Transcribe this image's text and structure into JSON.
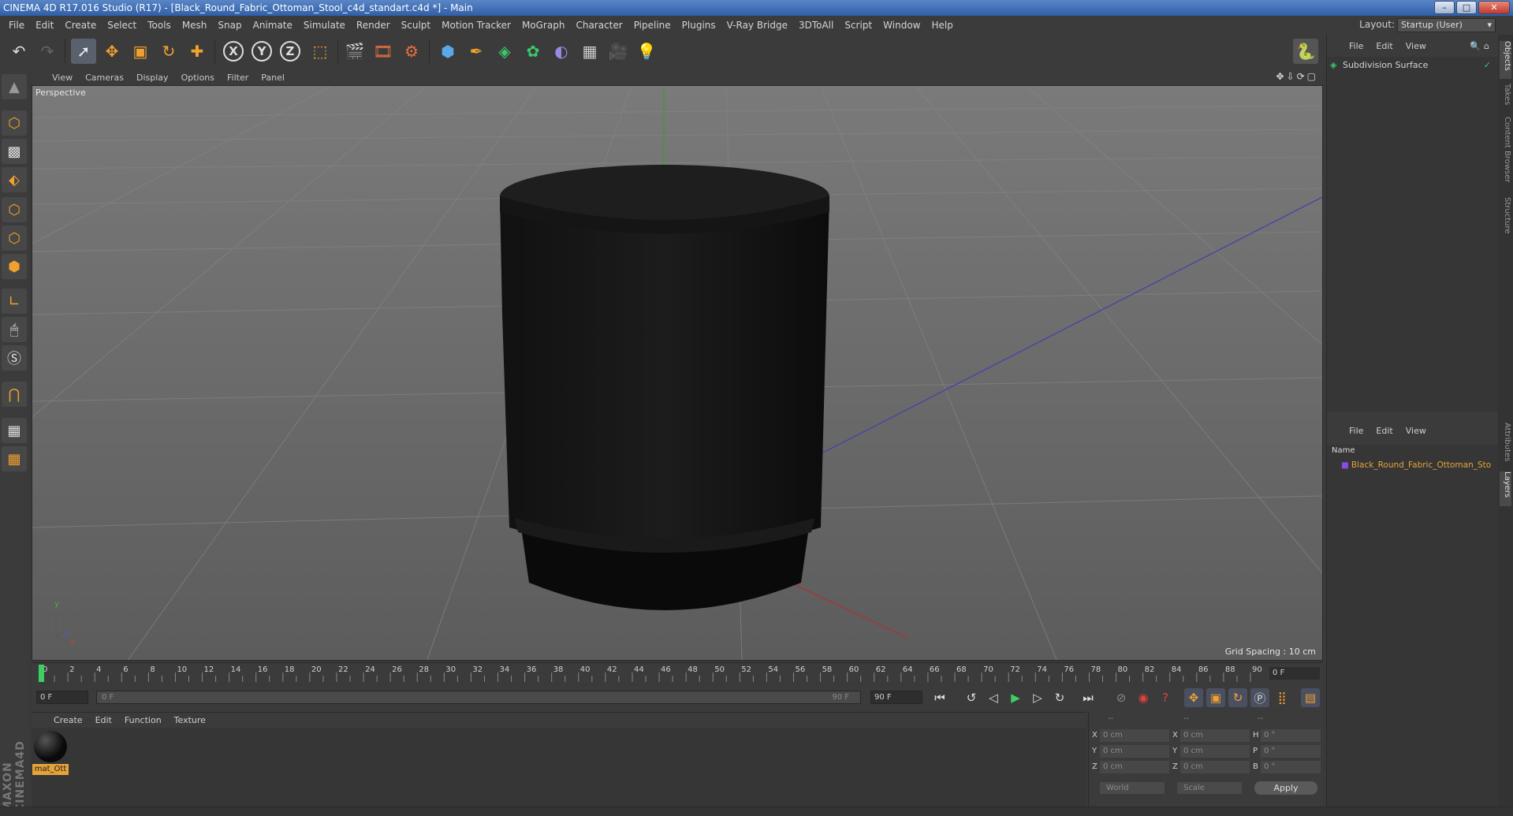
{
  "window": {
    "title": "CINEMA 4D R17.016 Studio (R17) - [Black_Round_Fabric_Ottoman_Stool_c4d_standart.c4d *] - Main",
    "btn_min": "–",
    "btn_max": "□",
    "btn_close": "✕"
  },
  "menu": [
    "File",
    "Edit",
    "Create",
    "Select",
    "Tools",
    "Mesh",
    "Snap",
    "Animate",
    "Simulate",
    "Render",
    "Sculpt",
    "Motion Tracker",
    "MoGraph",
    "Character",
    "Pipeline",
    "Plugins",
    "V-Ray Bridge",
    "3DToAll",
    "Script",
    "Window",
    "Help"
  ],
  "layout": {
    "label": "Layout:",
    "value": "Startup (User)"
  },
  "toolbar": {
    "icons": [
      "undo-icon",
      "redo-icon",
      "select-arrow-icon",
      "move-icon",
      "scale-icon",
      "rotate-icon",
      "transform-icon",
      "x-axis-icon",
      "y-axis-icon",
      "z-axis-icon",
      "coordinate-system-icon",
      "render-view-icon",
      "render-picture-viewer-icon",
      "edit-render-settings-icon",
      "cube-primitive-icon",
      "spline-pen-icon",
      "subdivision-icon",
      "mograph-cloner-icon",
      "deformer-icon",
      "floor-icon",
      "camera-icon",
      "light-icon"
    ],
    "axis_labels": [
      "X",
      "Y",
      "Z"
    ],
    "python_icon": "python-icon"
  },
  "viewport": {
    "menu": [
      "View",
      "Cameras",
      "Display",
      "Options",
      "Filter",
      "Panel"
    ],
    "label": "Perspective",
    "grid_spacing": "Grid Spacing : 10 cm",
    "axis_y": "y",
    "axis_x": "x",
    "axis_z": "z"
  },
  "timeline": {
    "ticks": [
      0,
      2,
      4,
      6,
      8,
      10,
      12,
      14,
      16,
      18,
      20,
      22,
      24,
      26,
      28,
      30,
      32,
      34,
      36,
      38,
      40,
      42,
      44,
      46,
      48,
      50,
      52,
      54,
      56,
      58,
      60,
      62,
      64,
      66,
      68,
      70,
      72,
      74,
      76,
      78,
      80,
      82,
      84,
      86,
      88,
      90
    ],
    "max": 90,
    "current_frame": 0,
    "frame_end_display": "0 F"
  },
  "playbar": {
    "start_field": "0 F",
    "range_start": "0 F",
    "range_end": "90 F",
    "end_field": "90 F"
  },
  "material": {
    "menu": [
      "Create",
      "Edit",
      "Function",
      "Texture"
    ],
    "name": "mat_Ott"
  },
  "maxon_logo": "MAXON CINEMA4D",
  "coords": {
    "header": [
      "--",
      "--",
      "--"
    ],
    "rows": [
      {
        "l1": "X",
        "v1": "0 cm",
        "l2": "X",
        "v2": "0 cm",
        "l3": "H",
        "v3": "0 °"
      },
      {
        "l1": "Y",
        "v1": "0 cm",
        "l2": "Y",
        "v2": "0 cm",
        "l3": "P",
        "v3": "0 °"
      },
      {
        "l1": "Z",
        "v1": "0 cm",
        "l2": "Z",
        "v2": "0 cm",
        "l3": "B",
        "v3": "0 °"
      }
    ],
    "space": "World",
    "mode": "Scale",
    "apply": "Apply"
  },
  "objects": {
    "menu": [
      "File",
      "Edit",
      "View"
    ],
    "item": "Subdivision Surface"
  },
  "layers": {
    "menu": [
      "File",
      "Edit",
      "View"
    ],
    "column": "Name",
    "item": "Black_Round_Fabric_Ottoman_Sto"
  },
  "right_tabs": [
    "Objects",
    "Takes",
    "Content Browser",
    "Structure",
    "Attributes",
    "Layers"
  ],
  "colors": {
    "accent": "#e6a33a",
    "material_label_text": "#1a1a1a",
    "layer_item": "#e6a33a"
  }
}
